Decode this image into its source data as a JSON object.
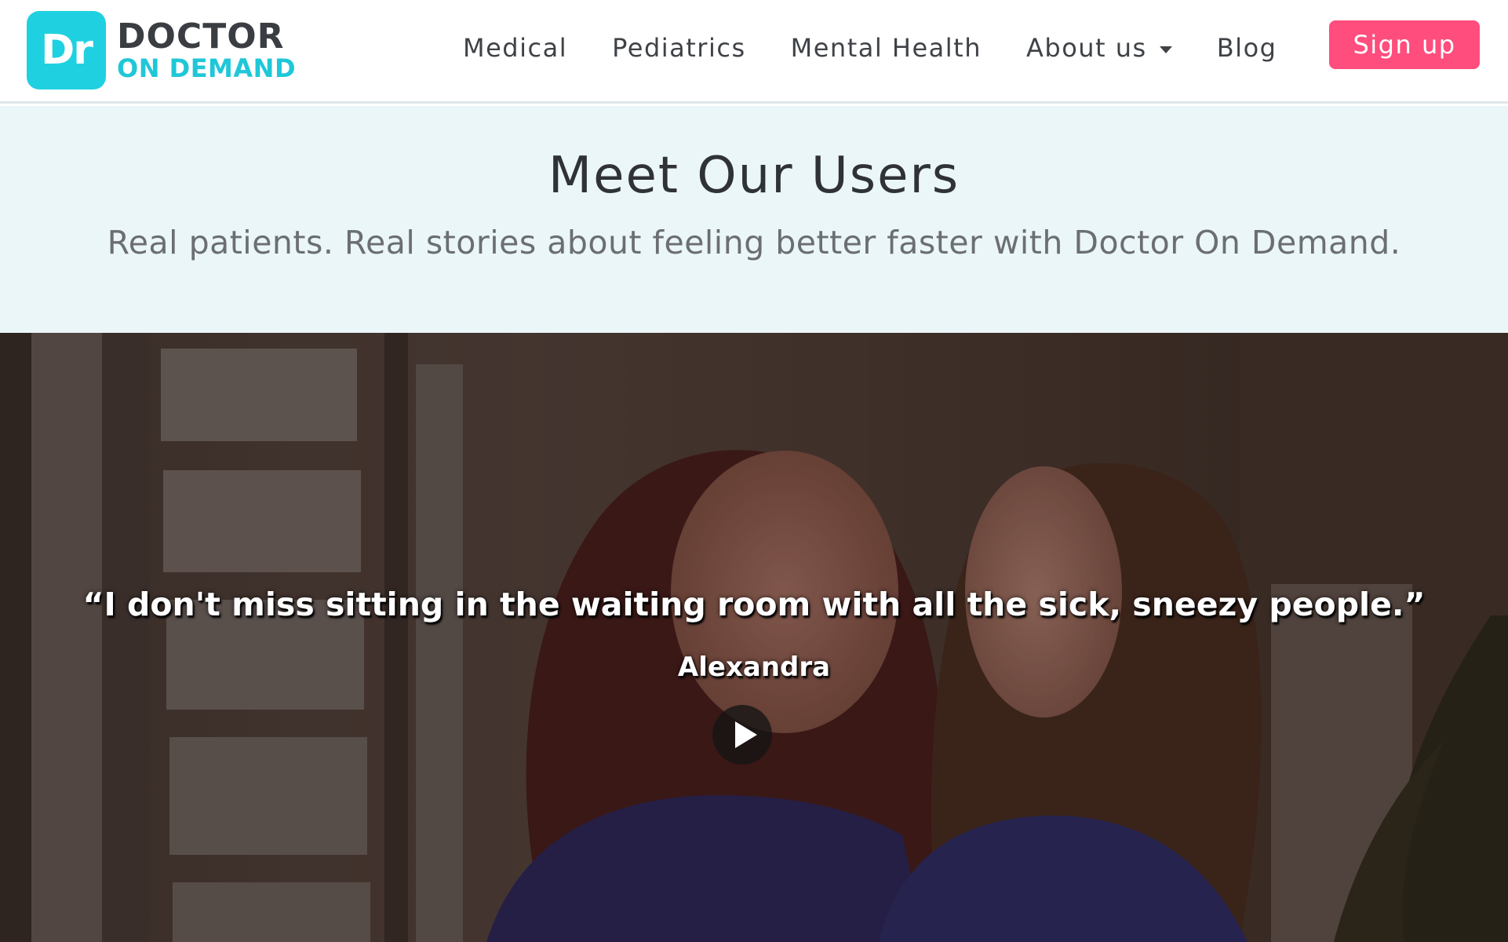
{
  "brand": {
    "badge": "Dr",
    "name_top": "DOCTOR",
    "name_bottom": "ON DEMAND",
    "badge_color": "#1fd1e0",
    "accent_color": "#1fc7d8"
  },
  "nav": {
    "items": [
      {
        "label": "Medical"
      },
      {
        "label": "Pediatrics"
      },
      {
        "label": "Mental Health"
      },
      {
        "label": "About us",
        "icon": "caret-down-icon"
      },
      {
        "label": "Blog"
      }
    ],
    "signup_label": "Sign up",
    "signup_color": "#ff4d7d"
  },
  "intro": {
    "title": "Meet Our Users",
    "subtitle": "Real patients. Real stories about feeling better faster with Doctor On Demand.",
    "background": "#ebf6f8"
  },
  "hero": {
    "quote": "“I don't miss sitting in the waiting room with all the sick, sneezy people.”",
    "author": "Alexandra",
    "play_icon": "play-icon"
  }
}
